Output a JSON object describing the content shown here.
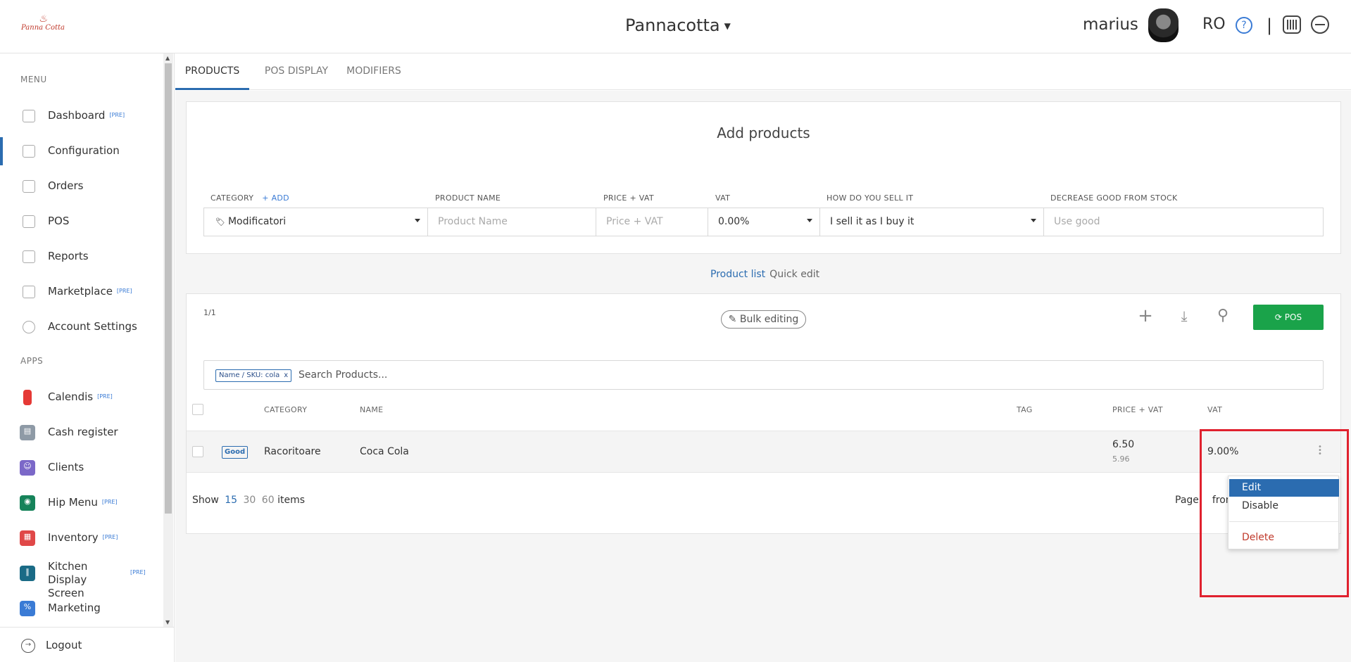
{
  "header": {
    "logo_text": "Panna Cotta",
    "venue": "Pannacotta",
    "user": "marius",
    "language": "RO",
    "help_glyph": "?",
    "separator": "|"
  },
  "sidebar": {
    "menu_section": "MENU",
    "apps_section": "APPS",
    "menu_items": [
      {
        "label": "Dashboard",
        "badge": "[PRE]",
        "icon": "bar-chart-icon"
      },
      {
        "label": "Configuration",
        "badge": "",
        "icon": "tag-icon"
      },
      {
        "label": "Orders",
        "badge": "",
        "icon": "basket-icon"
      },
      {
        "label": "POS",
        "badge": "",
        "icon": "monitor-icon"
      },
      {
        "label": "Reports",
        "badge": "",
        "icon": "line-chart-icon"
      },
      {
        "label": "Marketplace",
        "badge": "[PRE]",
        "icon": "cart-icon"
      },
      {
        "label": "Account Settings",
        "badge": "",
        "icon": "gear-icon"
      }
    ],
    "app_items": [
      {
        "label": "Calendis",
        "badge": "[PRE]",
        "color": "#e53935",
        "icon": "bookmark-icon"
      },
      {
        "label": "Cash register",
        "badge": "",
        "color": "#8e9aa6",
        "icon": "cash-register-icon"
      },
      {
        "label": "Clients",
        "badge": "",
        "color": "#7b68c8",
        "icon": "clients-icon"
      },
      {
        "label": "Hip Menu",
        "badge": "[PRE]",
        "color": "#16835a",
        "icon": "hip-menu-icon"
      },
      {
        "label": "Inventory",
        "badge": "[PRE]",
        "color": "#e04848",
        "icon": "inventory-icon"
      },
      {
        "label": "Kitchen Display Screen",
        "badge": "[PRE]",
        "color": "#1a6b86",
        "icon": "kitchen-icon"
      },
      {
        "label": "Marketing",
        "badge": "",
        "color": "#3a7bd5",
        "icon": "marketing-icon"
      }
    ],
    "logout": "Logout"
  },
  "tabs": [
    "PRODUCTS",
    "POS DISPLAY",
    "MODIFIERS"
  ],
  "add_products": {
    "title": "Add products",
    "labels": {
      "category": "CATEGORY",
      "add": "+ ADD",
      "product_name": "PRODUCT NAME",
      "price_vat": "PRICE + VAT",
      "vat": "VAT",
      "how_sell": "HOW DO YOU SELL IT",
      "decrease": "DECREASE GOOD FROM STOCK"
    },
    "values": {
      "category": "Modificatori",
      "product_name_placeholder": "Product Name",
      "price_placeholder": "Price + VAT",
      "vat": "0.00%",
      "how_sell": "I sell it as I buy it",
      "decrease_placeholder": "Use good"
    }
  },
  "view_links": {
    "product_list": "Product list",
    "quick_edit": "Quick edit"
  },
  "list": {
    "page_count": "1/1",
    "bulk_editing": "Bulk editing",
    "pos_button": "POS",
    "filter_chip": "Name / SKU: cola",
    "chip_close": "x",
    "search_placeholder": "Search Products...",
    "columns": {
      "category": "CATEGORY",
      "name": "NAME",
      "tag": "TAG",
      "price": "PRICE + VAT",
      "vat": "VAT"
    },
    "rows": [
      {
        "type": "Good",
        "category": "Racoritoare",
        "name": "Coca Cola",
        "tag": "",
        "price": "6.50",
        "price_net": "5.96",
        "vat": "9.00%"
      }
    ],
    "show_label": "Show",
    "page_sizes": [
      "15",
      "30",
      "60"
    ],
    "items_label": "items",
    "page_label": "Page",
    "from_label": "from"
  },
  "row_menu": {
    "edit": "Edit",
    "disable": "Disable",
    "delete": "Delete"
  },
  "colors": {
    "accent": "#2b6cb0",
    "pos_green": "#1aa34a",
    "highlight_red": "#e0212e",
    "danger": "#c0392b"
  }
}
